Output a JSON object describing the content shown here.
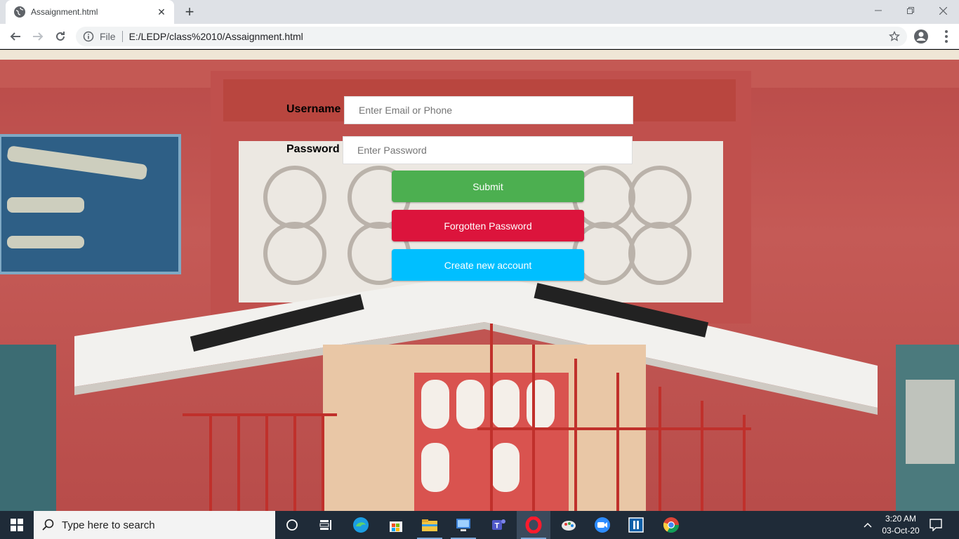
{
  "browser": {
    "tab_title": "Assaignment.html",
    "tab_close_glyph": "✕",
    "new_tab_glyph": "+",
    "scheme_label": "File",
    "url": "E:/LEDP/class%2010/Assaignment.html"
  },
  "form": {
    "username_label": "Username",
    "username_placeholder": "Enter Email or Phone",
    "password_label": "Password",
    "password_placeholder": "Enter Password",
    "submit_label": "Submit",
    "forgot_label": "Forgotten Password",
    "create_label": "Create new account"
  },
  "colors": {
    "submit": "#4caf50",
    "forgot": "#dc143c",
    "create": "#00bfff",
    "wall": "#b94a48",
    "taskbar": "#1f2b38"
  },
  "taskbar": {
    "search_placeholder": "Type here to search",
    "time": "3:20 AM",
    "date": "03-Oct-20",
    "pinned": [
      "task-view-icon",
      "widgets-icon",
      "edge-icon",
      "store-icon",
      "file-explorer-icon",
      "network-icon",
      "teams-icon",
      "opera-icon",
      "paint-icon",
      "zoom-icon",
      "app-icon",
      "chrome-icon"
    ]
  }
}
